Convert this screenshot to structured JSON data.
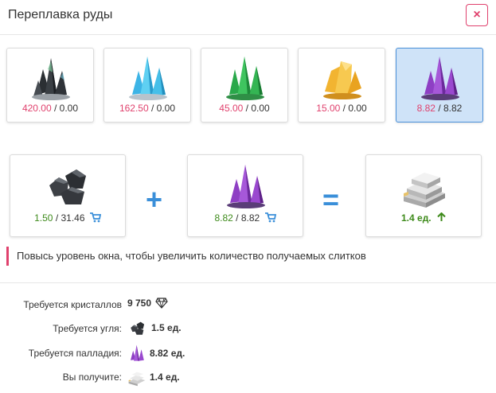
{
  "window": {
    "title": "Переплавка руды",
    "close_label": "×"
  },
  "ores": [
    {
      "name": "dark-crystal",
      "amount": "420.00",
      "sep": " / ",
      "max": "0.00",
      "selected": false
    },
    {
      "name": "blue-crystal",
      "amount": "162.50",
      "sep": " / ",
      "max": "0.00",
      "selected": false
    },
    {
      "name": "green-crystal",
      "amount": "45.00",
      "sep": " / ",
      "max": "0.00",
      "selected": false
    },
    {
      "name": "yellow-crystal",
      "amount": "15.00",
      "sep": " / ",
      "max": "0.00",
      "selected": false
    },
    {
      "name": "purple-crystal",
      "amount": "8.82",
      "sep": " / ",
      "max": "8.82",
      "selected": true
    }
  ],
  "recipe": {
    "coal": {
      "have": "1.50",
      "sep": " / ",
      "need": "31.46"
    },
    "palladium": {
      "have": "8.82",
      "sep": " / ",
      "need": "8.82"
    },
    "result": {
      "value": "1.4 ед."
    },
    "plus": "+",
    "equals": "="
  },
  "hint": "Повысь уровень окна, чтобы увеличить количество получаемых слитков",
  "requirements": [
    {
      "label": "Требуется кристаллов",
      "value": "9 750",
      "icon": "diamond-icon"
    },
    {
      "label": "Требуется угля:",
      "value": "1.5 ед.",
      "icon": "coal-icon"
    },
    {
      "label": "Требуется палладия:",
      "value": "8.82 ед.",
      "icon": "purple-crystal-icon"
    },
    {
      "label": "Вы получите:",
      "value": "1.4 ед.",
      "icon": "ingot-icon"
    }
  ],
  "colors": {
    "accent_blue": "#3a8fd9",
    "pink": "#e0416d",
    "green": "#3d8a1a",
    "selected_bg": "#cfe3f8"
  }
}
